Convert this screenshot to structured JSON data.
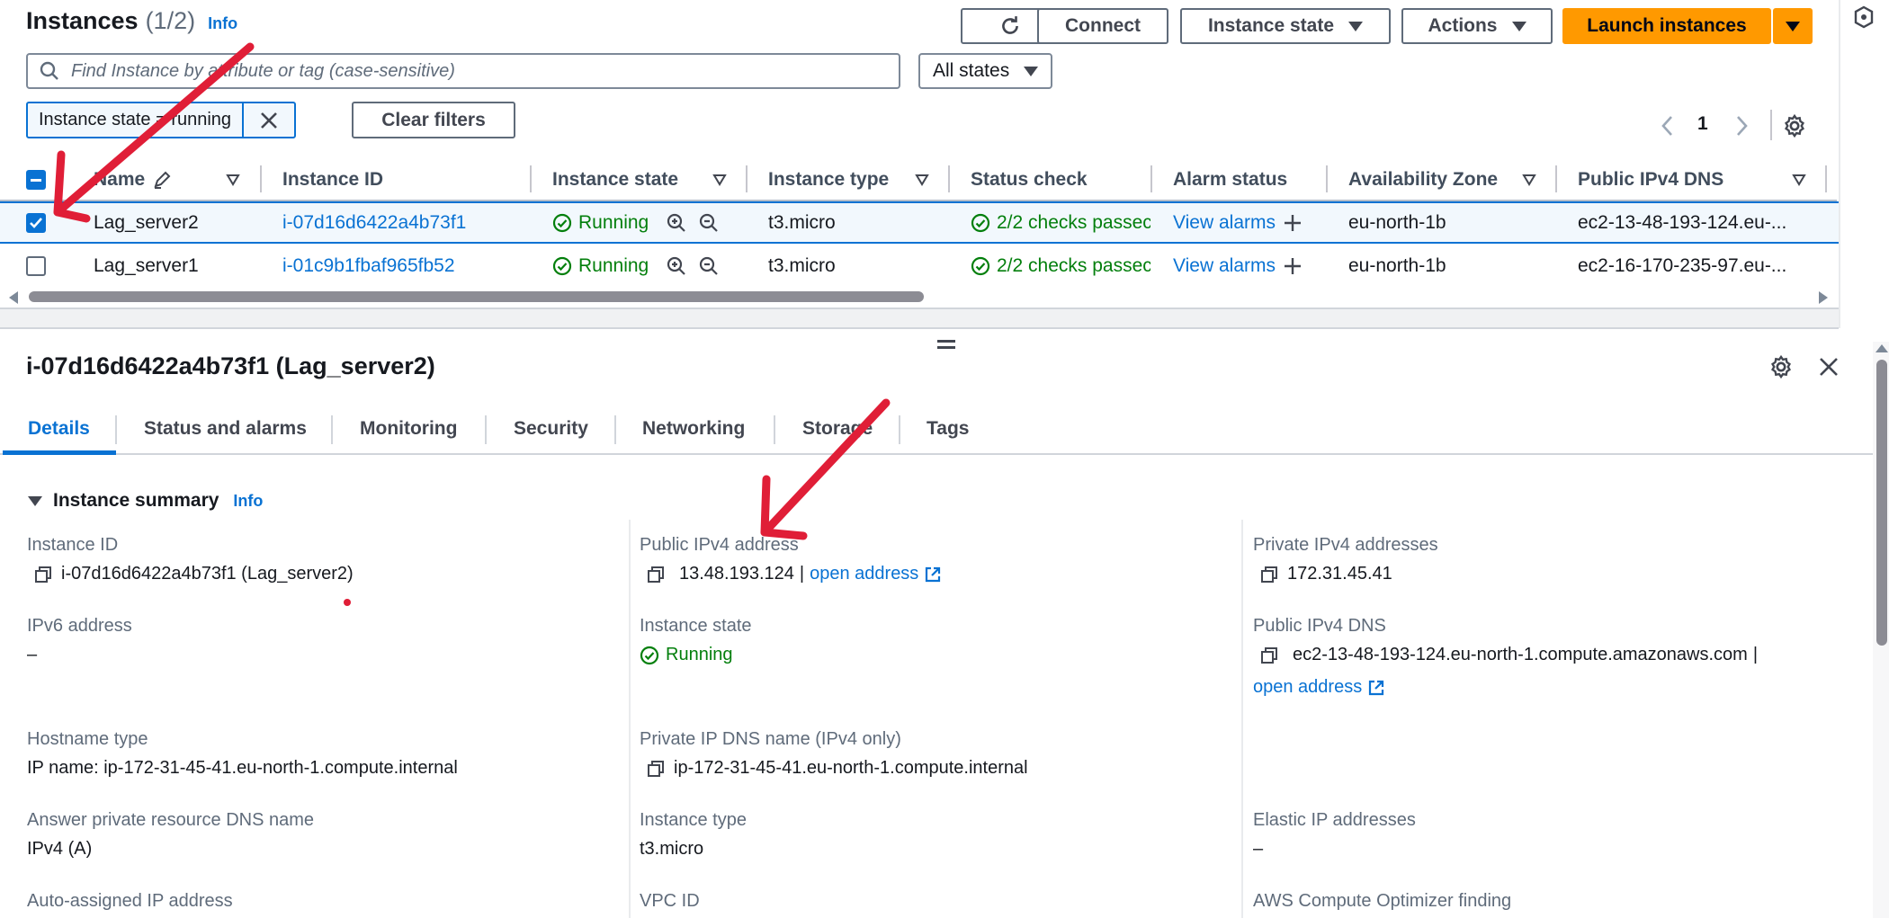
{
  "header": {
    "title": "Instances",
    "count": "(1/2)",
    "info": "Info",
    "connect": "Connect",
    "instance_state": "Instance state",
    "actions": "Actions",
    "launch": "Launch instances"
  },
  "search": {
    "placeholder": "Find Instance by attribute or tag (case-sensitive)"
  },
  "state_filter": {
    "selected": "All states"
  },
  "filter_token": {
    "label": "Instance state = running"
  },
  "clear_filters": "Clear filters",
  "pagination": {
    "page": "1"
  },
  "table": {
    "columns": [
      "Name",
      "Instance ID",
      "Instance state",
      "Instance type",
      "Status check",
      "Alarm status",
      "Availability Zone",
      "Public IPv4 DNS"
    ],
    "rows": [
      {
        "name": "Lag_server2",
        "id": "i-07d16d6422a4b73f1",
        "state": "Running",
        "type": "t3.micro",
        "status": "2/2 checks passec",
        "alarm": "View alarms",
        "az": "eu-north-1b",
        "dns": "ec2-13-48-193-124.eu-...",
        "selected": true
      },
      {
        "name": "Lag_server1",
        "id": "i-01c9b1fbaf965fb52",
        "state": "Running",
        "type": "t3.micro",
        "status": "2/2 checks passec",
        "alarm": "View alarms",
        "az": "eu-north-1b",
        "dns": "ec2-16-170-235-97.eu-...",
        "selected": false
      }
    ]
  },
  "detail": {
    "title": "i-07d16d6422a4b73f1 (Lag_server2)",
    "tabs": [
      "Details",
      "Status and alarms",
      "Monitoring",
      "Security",
      "Networking",
      "Storage",
      "Tags"
    ],
    "section": "Instance summary",
    "info": "Info",
    "fields": {
      "instance_id_label": "Instance ID",
      "instance_id_value": "i-07d16d6422a4b73f1 (Lag_server2)",
      "public_ipv4_label": "Public IPv4 address",
      "public_ipv4_value": "13.48.193.124",
      "public_ipv4_sep": "|",
      "open_address": "open address",
      "private_ipv4_label": "Private IPv4 addresses",
      "private_ipv4_value": "172.31.45.41",
      "ipv6_label": "IPv6 address",
      "ipv6_value": "–",
      "instance_state_label": "Instance state",
      "instance_state_value": "Running",
      "public_dns_label": "Public IPv4 DNS",
      "public_dns_value": "ec2-13-48-193-124.eu-north-1.compute.amazonaws.com",
      "public_dns_sep": "|",
      "hostname_type_label": "Hostname type",
      "hostname_type_value": "IP name: ip-172-31-45-41.eu-north-1.compute.internal",
      "private_dns_label": "Private IP DNS name (IPv4 only)",
      "private_dns_value": "ip-172-31-45-41.eu-north-1.compute.internal",
      "answer_dns_label": "Answer private resource DNS name",
      "answer_dns_value": "IPv4 (A)",
      "instance_type_label": "Instance type",
      "instance_type_value": "t3.micro",
      "elastic_ip_label": "Elastic IP addresses",
      "elastic_ip_value": "–",
      "auto_ip_label": "Auto-assigned IP address",
      "vpc_label": "VPC ID",
      "optimizer_label": "AWS Compute Optimizer finding"
    }
  },
  "colors": {
    "accent": "#0972d3",
    "launch": "#ff9900",
    "running": "#037f0c",
    "annotation": "#e01e37"
  }
}
